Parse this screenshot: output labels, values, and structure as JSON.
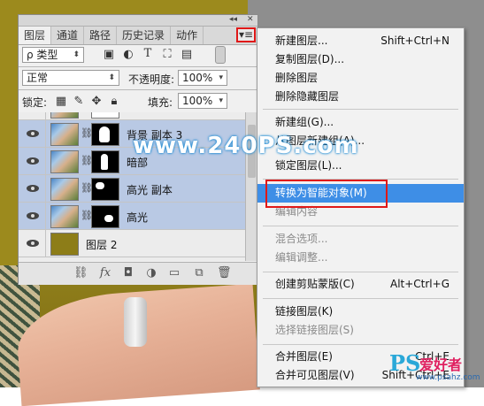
{
  "panel": {
    "collapse_glyph": "◂◂",
    "close_glyph": "✕",
    "tabs": [
      "图层",
      "通道",
      "路径",
      "历史记录",
      "动作"
    ],
    "menu_glyph": "▾≡",
    "filter": {
      "label": "ρ 类型",
      "icons": [
        "image-filter-icon",
        "adjustment-filter-icon",
        "type-filter-icon",
        "shape-filter-icon",
        "smart-object-filter-icon"
      ]
    },
    "blend_mode": "正常",
    "opacity_label": "不透明度:",
    "opacity_value": "100%",
    "lock_label": "锁定:",
    "fill_label": "填充:",
    "fill_value": "100%",
    "layers": [
      {
        "name": "背景 副本 3",
        "selected": true,
        "type": "masked"
      },
      {
        "name": "暗部",
        "selected": true,
        "type": "masked"
      },
      {
        "name": "高光 副本",
        "selected": true,
        "type": "masked"
      },
      {
        "name": "高光",
        "selected": true,
        "type": "masked"
      },
      {
        "name": "图层 2",
        "selected": false,
        "type": "fill"
      }
    ],
    "bottom_icons": [
      "link-icon",
      "fx-icon",
      "mask-icon",
      "adjustment-icon",
      "folder-icon",
      "new-layer-icon",
      "trash-icon"
    ]
  },
  "context_menu": {
    "items": [
      {
        "label": "新建图层...",
        "shortcut": "Shift+Ctrl+N",
        "state": "normal"
      },
      {
        "label": "复制图层(D)...",
        "shortcut": "",
        "state": "normal"
      },
      {
        "label": "删除图层",
        "shortcut": "",
        "state": "normal"
      },
      {
        "label": "删除隐藏图层",
        "shortcut": "",
        "state": "normal"
      },
      {
        "sep": true
      },
      {
        "label": "新建组(G)...",
        "shortcut": "",
        "state": "normal"
      },
      {
        "label": "从图层新建组(A)...",
        "shortcut": "",
        "state": "normal"
      },
      {
        "label": "锁定图层(L)...",
        "shortcut": "",
        "state": "normal"
      },
      {
        "sep": true
      },
      {
        "label": "转换为智能对象(M)",
        "shortcut": "",
        "state": "highlight"
      },
      {
        "label": "编辑内容",
        "shortcut": "",
        "state": "disabled"
      },
      {
        "sep": true
      },
      {
        "label": "混合选项...",
        "shortcut": "",
        "state": "disabled"
      },
      {
        "label": "编辑调整...",
        "shortcut": "",
        "state": "disabled"
      },
      {
        "sep": true
      },
      {
        "label": "创建剪贴蒙版(C)",
        "shortcut": "Alt+Ctrl+G",
        "state": "normal"
      },
      {
        "sep": true
      },
      {
        "label": "链接图层(K)",
        "shortcut": "",
        "state": "normal"
      },
      {
        "label": "选择链接图层(S)",
        "shortcut": "",
        "state": "disabled"
      },
      {
        "sep": true
      },
      {
        "label": "合并图层(E)",
        "shortcut": "Ctrl+E",
        "state": "normal"
      },
      {
        "label": "合并可见图层(V)",
        "shortcut": "Shift+Ctrl+E",
        "state": "normal"
      }
    ]
  },
  "watermark": "www.240PS.com",
  "logo": {
    "ps": "PS",
    "text": "爱好者",
    "url": "www.psahz.com"
  },
  "colors": {
    "highlight": "#3e8ee6",
    "callout": "#e01818",
    "selected_layer": "#b9c9e4"
  }
}
